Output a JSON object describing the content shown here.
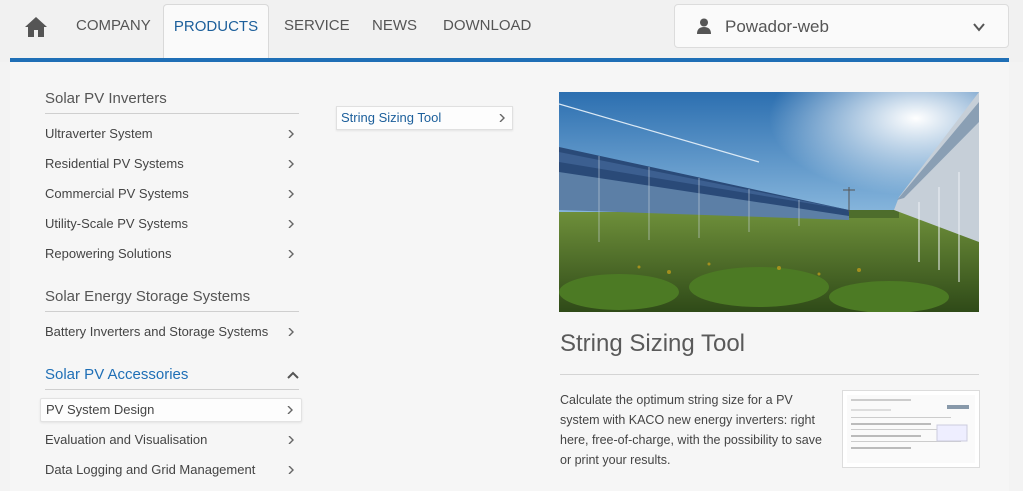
{
  "nav": {
    "items": [
      {
        "label": "COMPANY",
        "active": false
      },
      {
        "label": "PRODUCTS",
        "active": true
      },
      {
        "label": "SERVICE",
        "active": false
      },
      {
        "label": "NEWS",
        "active": false
      },
      {
        "label": "DOWNLOAD",
        "active": false
      }
    ],
    "user_label": "Powador-web",
    "accent_color": "#1f6fb6"
  },
  "sidebar": {
    "categories": [
      {
        "title": "Solar PV Inverters",
        "items": [
          "Ultraverter System",
          "Residential PV Systems",
          "Commercial PV Systems",
          "Utility-Scale PV Systems",
          "Repowering Solutions"
        ]
      },
      {
        "title": "Solar Energy Storage Systems",
        "items": [
          "Battery Inverters and Storage Systems"
        ]
      },
      {
        "title": "Solar PV Accessories",
        "expanded": true,
        "items": [
          "PV System Design",
          "Evaluation and Visualisation",
          "Data Logging and Grid Management"
        ],
        "selected_item": "PV System Design"
      }
    ]
  },
  "subnav": {
    "item": "String Sizing Tool"
  },
  "main": {
    "title": "String Sizing Tool",
    "description": "Calculate the optimum string size for a PV system with KACO new energy inverters: right here, free-of-charge, with the possibility to save or print your results."
  }
}
